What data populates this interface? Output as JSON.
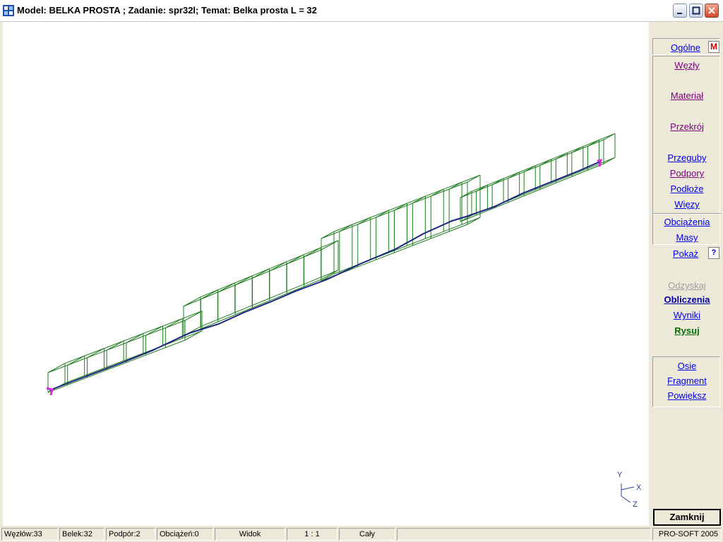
{
  "window": {
    "title": "Model: BELKA PROSTA ;  Zadanie: spr32l;  Temat: Belka prosta L = 32"
  },
  "panel": {
    "m_badge": "M",
    "help_badge": "?",
    "items": [
      {
        "label": "Ogólne"
      },
      {
        "label": "Węzły"
      },
      {
        "label": "Materiał"
      },
      {
        "label": "Przekrój"
      },
      {
        "label": "Przeguby"
      },
      {
        "label": "Podpory"
      },
      {
        "label": "Podłoże"
      },
      {
        "label": "Więzy"
      },
      {
        "label": "Obciążenia"
      },
      {
        "label": "Masy"
      },
      {
        "label": "Pokaż"
      },
      {
        "label": "Odzyskaj"
      },
      {
        "label": "Obliczenia"
      },
      {
        "label": "Wyniki"
      },
      {
        "label": "Rysuj"
      },
      {
        "label": "Osie"
      },
      {
        "label": "Fragment"
      },
      {
        "label": "Powiększ"
      }
    ],
    "close_label": "Zamknij"
  },
  "axes": {
    "x": "X",
    "y": "Y",
    "z": "Z"
  },
  "status": {
    "nodes": "Węzłów:33",
    "beams": "Belek:32",
    "supports": "Podpór:2",
    "loads": "Obciążeń:0",
    "view": "Widok",
    "scale": "1 : 1",
    "range": "Cały",
    "empty": "",
    "brand": "PRO-SOFT 2005"
  },
  "colors": {
    "beam_axis": "#1a237e",
    "section_wire": "#1e7b1e",
    "support": "#d62fd6",
    "visited_link": "#800080",
    "link": "#0000ee",
    "disabled": "#a0a0a0",
    "active": "#007000"
  }
}
